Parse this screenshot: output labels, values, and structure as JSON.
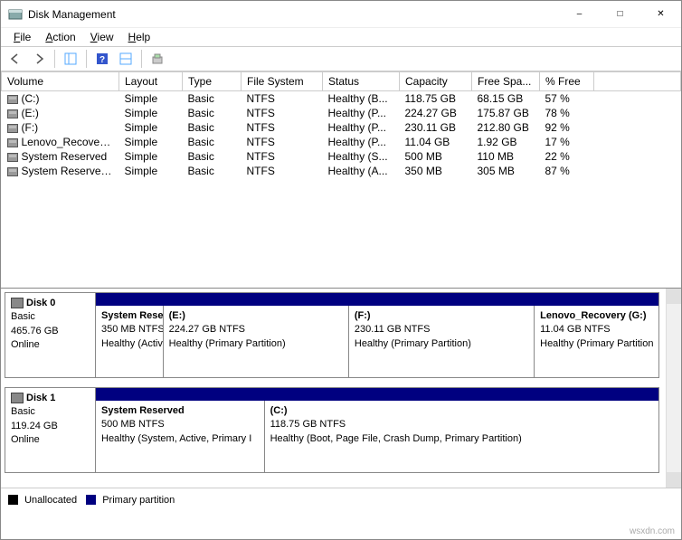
{
  "window": {
    "title": "Disk Management"
  },
  "menu": {
    "file": "File",
    "action": "Action",
    "view": "View",
    "help": "Help"
  },
  "columns": {
    "volume": "Volume",
    "layout": "Layout",
    "type": "Type",
    "fs": "File System",
    "status": "Status",
    "capacity": "Capacity",
    "free": "Free Spa...",
    "pctfree": "% Free"
  },
  "volumes": [
    {
      "name": "(C:)",
      "layout": "Simple",
      "type": "Basic",
      "fs": "NTFS",
      "status": "Healthy (B...",
      "capacity": "118.75 GB",
      "free": "68.15 GB",
      "pct": "57 %"
    },
    {
      "name": "(E:)",
      "layout": "Simple",
      "type": "Basic",
      "fs": "NTFS",
      "status": "Healthy (P...",
      "capacity": "224.27 GB",
      "free": "175.87 GB",
      "pct": "78 %"
    },
    {
      "name": "(F:)",
      "layout": "Simple",
      "type": "Basic",
      "fs": "NTFS",
      "status": "Healthy (P...",
      "capacity": "230.11 GB",
      "free": "212.80 GB",
      "pct": "92 %"
    },
    {
      "name": "Lenovo_Recovery ...",
      "layout": "Simple",
      "type": "Basic",
      "fs": "NTFS",
      "status": "Healthy (P...",
      "capacity": "11.04 GB",
      "free": "1.92 GB",
      "pct": "17 %"
    },
    {
      "name": "System Reserved",
      "layout": "Simple",
      "type": "Basic",
      "fs": "NTFS",
      "status": "Healthy (S...",
      "capacity": "500 MB",
      "free": "110 MB",
      "pct": "22 %"
    },
    {
      "name": "System Reserved (...",
      "layout": "Simple",
      "type": "Basic",
      "fs": "NTFS",
      "status": "Healthy (A...",
      "capacity": "350 MB",
      "free": "305 MB",
      "pct": "87 %"
    }
  ],
  "disks": [
    {
      "label": "Disk 0",
      "type": "Basic",
      "size": "465.76 GB",
      "status": "Online",
      "partitions": [
        {
          "title": "System Reser",
          "line2": "350 MB NTFS",
          "line3": "Healthy (Activ",
          "width": "12%"
        },
        {
          "title": "(E:)",
          "line2": "224.27 GB NTFS",
          "line3": "Healthy (Primary Partition)",
          "width": "33%"
        },
        {
          "title": "(F:)",
          "line2": "230.11 GB NTFS",
          "line3": "Healthy (Primary Partition)",
          "width": "33%"
        },
        {
          "title": "Lenovo_Recovery  (G:)",
          "line2": "11.04 GB NTFS",
          "line3": "Healthy (Primary Partition",
          "width": "22%"
        }
      ]
    },
    {
      "label": "Disk 1",
      "type": "Basic",
      "size": "119.24 GB",
      "status": "Online",
      "partitions": [
        {
          "title": "System Reserved",
          "line2": "500 MB NTFS",
          "line3": "Healthy (System, Active, Primary I",
          "width": "30%"
        },
        {
          "title": "(C:)",
          "line2": "118.75 GB NTFS",
          "line3": "Healthy (Boot, Page File, Crash Dump, Primary Partition)",
          "width": "70%"
        }
      ]
    }
  ],
  "legend": {
    "unallocated": "Unallocated",
    "primary": "Primary partition"
  },
  "footer": "wsxdn.com",
  "colors": {
    "unallocated": "#000000",
    "primary": "#000080"
  }
}
